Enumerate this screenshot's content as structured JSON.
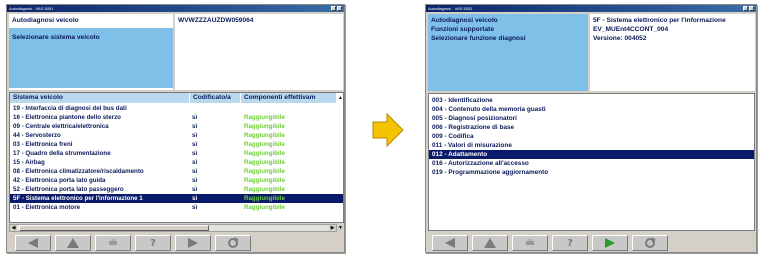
{
  "left_window": {
    "title": "Autodiagnosi - VAS 5051",
    "header_labels": [
      "Autodiagnosi veicolo",
      "Selezionare sistema veicolo"
    ],
    "vin": "WVWZZZAUZDW059064",
    "columns": [
      "Sistema veicolo",
      "Codificato/a",
      "Componenti effettivam"
    ],
    "rows": [
      {
        "system": "19 - Interfaccia di diagnosi del bus dati",
        "coded": "",
        "status": "",
        "selected": false
      },
      {
        "system": "16 - Elettronica piantone dello sterzo",
        "coded": "sì",
        "status": "Raggiungibile",
        "selected": false
      },
      {
        "system": "09 - Centrale elettrica/elettronica",
        "coded": "sì",
        "status": "Raggiungibile",
        "selected": false
      },
      {
        "system": "44 - Servosterzo",
        "coded": "sì",
        "status": "Raggiungibile",
        "selected": false
      },
      {
        "system": "03 - Elettronica freni",
        "coded": "sì",
        "status": "Raggiungibile",
        "selected": false
      },
      {
        "system": "17 - Quadro della strumentazione",
        "coded": "sì",
        "status": "Raggiungibile",
        "selected": false
      },
      {
        "system": "15 - Airbag",
        "coded": "sì",
        "status": "Raggiungibile",
        "selected": false
      },
      {
        "system": "08 - Elettronica climatizzatore/riscaldamento",
        "coded": "sì",
        "status": "Raggiungibile",
        "selected": false
      },
      {
        "system": "42 - Elettronica porta lato guida",
        "coded": "sì",
        "status": "Raggiungibile",
        "selected": false
      },
      {
        "system": "52 - Elettronica porta lato passeggero",
        "coded": "sì",
        "status": "Raggiungibile",
        "selected": false
      },
      {
        "system": "5F - Sistema elettronico per l'informazione 1",
        "coded": "sì",
        "status": "Raggiungibile",
        "selected": true
      },
      {
        "system": "01 - Elettronica motore",
        "coded": "sì",
        "status": "Raggiungibile",
        "selected": false
      }
    ]
  },
  "right_window": {
    "title": "Autodiagnosi - VAS 5051",
    "header_labels": [
      "Autodiagnosi veicolo",
      "Funzioni supportate",
      "Selezionare funzione diagnosi"
    ],
    "header_values": [
      "5F - Sistema elettronico per l'informazione",
      "EV_MUEnt4CCONT_004",
      "Versione: 004052"
    ],
    "functions": [
      {
        "label": "003 - Identificazione",
        "selected": false
      },
      {
        "label": "004 - Contenuto della memoria guasti",
        "selected": false
      },
      {
        "label": "005 - Diagnosi posizionatori",
        "selected": false
      },
      {
        "label": "006 - Registrazione di base",
        "selected": false
      },
      {
        "label": "009 - Codifica",
        "selected": false
      },
      {
        "label": "011 - Valori di misurazione",
        "selected": false
      },
      {
        "label": "012 - Adattamento",
        "selected": true
      },
      {
        "label": "016 - Autorizzazione all'accesso",
        "selected": false
      },
      {
        "label": "019 - Programmazione aggiornamento",
        "selected": false
      }
    ]
  },
  "toolbar": {
    "help_label": "?",
    "icons": [
      "back-arrow-icon",
      "up-arrow-icon",
      "print-icon",
      "help-icon",
      "forward-arrow-icon",
      "refresh-icon"
    ]
  },
  "colors": {
    "accent_arrow": "#f5c400",
    "selection": "#0a1a6a",
    "status_ok": "#6fcf3a",
    "forward_active": "#2a9a2a"
  }
}
